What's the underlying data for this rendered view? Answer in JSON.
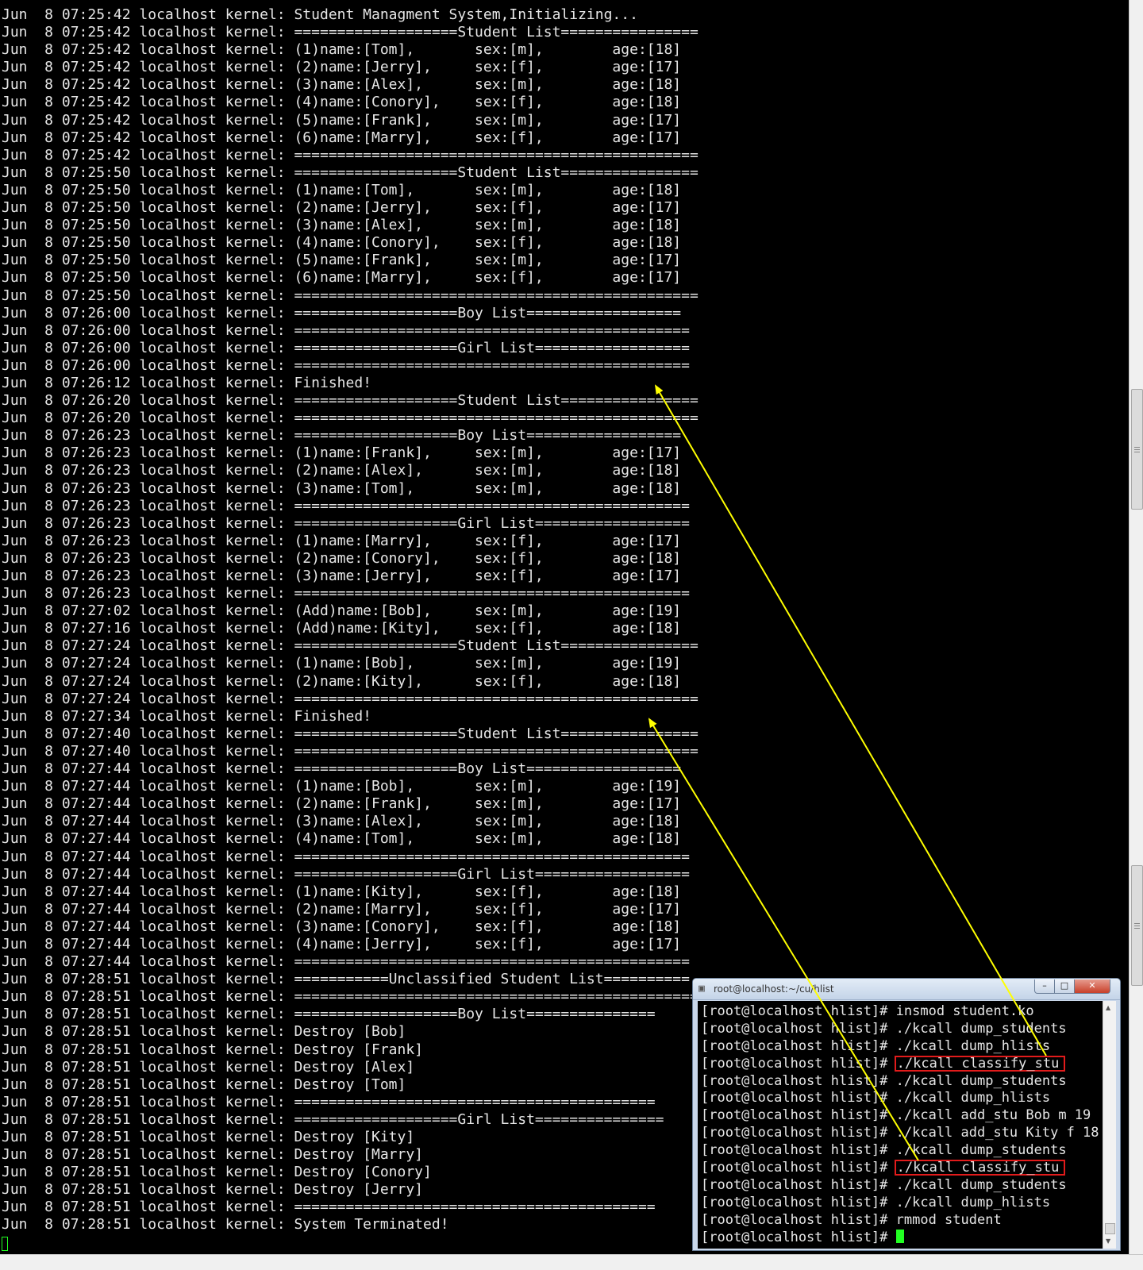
{
  "main_terminal": {
    "lines": [
      {
        "prefix": "Jun  8 07:25:42 localhost kernel: ",
        "message": "Student Managment System,Initializing..."
      },
      {
        "prefix": "Jun  8 07:25:42 localhost kernel: ",
        "message": "===================Student List================"
      },
      {
        "prefix": "Jun  8 07:25:42 localhost kernel: ",
        "message": "(1)name:[Tom],       sex:[m],        age:[18]"
      },
      {
        "prefix": "Jun  8 07:25:42 localhost kernel: ",
        "message": "(2)name:[Jerry],     sex:[f],        age:[17]"
      },
      {
        "prefix": "Jun  8 07:25:42 localhost kernel: ",
        "message": "(3)name:[Alex],      sex:[m],        age:[18]"
      },
      {
        "prefix": "Jun  8 07:25:42 localhost kernel: ",
        "message": "(4)name:[Conory],    sex:[f],        age:[18]"
      },
      {
        "prefix": "Jun  8 07:25:42 localhost kernel: ",
        "message": "(5)name:[Frank],     sex:[m],        age:[17]"
      },
      {
        "prefix": "Jun  8 07:25:42 localhost kernel: ",
        "message": "(6)name:[Marry],     sex:[f],        age:[17]"
      },
      {
        "prefix": "Jun  8 07:25:42 localhost kernel: ",
        "message": "==============================================="
      },
      {
        "prefix": "Jun  8 07:25:50 localhost kernel: ",
        "message": "===================Student List================"
      },
      {
        "prefix": "Jun  8 07:25:50 localhost kernel: ",
        "message": "(1)name:[Tom],       sex:[m],        age:[18]"
      },
      {
        "prefix": "Jun  8 07:25:50 localhost kernel: ",
        "message": "(2)name:[Jerry],     sex:[f],        age:[17]"
      },
      {
        "prefix": "Jun  8 07:25:50 localhost kernel: ",
        "message": "(3)name:[Alex],      sex:[m],        age:[18]"
      },
      {
        "prefix": "Jun  8 07:25:50 localhost kernel: ",
        "message": "(4)name:[Conory],    sex:[f],        age:[18]"
      },
      {
        "prefix": "Jun  8 07:25:50 localhost kernel: ",
        "message": "(5)name:[Frank],     sex:[m],        age:[17]"
      },
      {
        "prefix": "Jun  8 07:25:50 localhost kernel: ",
        "message": "(6)name:[Marry],     sex:[f],        age:[17]"
      },
      {
        "prefix": "Jun  8 07:25:50 localhost kernel: ",
        "message": "==============================================="
      },
      {
        "prefix": "Jun  8 07:26:00 localhost kernel: ",
        "message": "===================Boy List=================="
      },
      {
        "prefix": "Jun  8 07:26:00 localhost kernel: ",
        "message": "=============================================="
      },
      {
        "prefix": "Jun  8 07:26:00 localhost kernel: ",
        "message": "===================Girl List=================="
      },
      {
        "prefix": "Jun  8 07:26:00 localhost kernel: ",
        "message": "=============================================="
      },
      {
        "prefix": "Jun  8 07:26:12 localhost kernel: ",
        "message": "Finished!"
      },
      {
        "prefix": "Jun  8 07:26:20 localhost kernel: ",
        "message": "===================Student List================"
      },
      {
        "prefix": "Jun  8 07:26:20 localhost kernel: ",
        "message": "==============================================="
      },
      {
        "prefix": "Jun  8 07:26:23 localhost kernel: ",
        "message": "===================Boy List=================="
      },
      {
        "prefix": "Jun  8 07:26:23 localhost kernel: ",
        "message": "(1)name:[Frank],     sex:[m],        age:[17]"
      },
      {
        "prefix": "Jun  8 07:26:23 localhost kernel: ",
        "message": "(2)name:[Alex],      sex:[m],        age:[18]"
      },
      {
        "prefix": "Jun  8 07:26:23 localhost kernel: ",
        "message": "(3)name:[Tom],       sex:[m],        age:[18]"
      },
      {
        "prefix": "Jun  8 07:26:23 localhost kernel: ",
        "message": "=============================================="
      },
      {
        "prefix": "Jun  8 07:26:23 localhost kernel: ",
        "message": "===================Girl List=================="
      },
      {
        "prefix": "Jun  8 07:26:23 localhost kernel: ",
        "message": "(1)name:[Marry],     sex:[f],        age:[17]"
      },
      {
        "prefix": "Jun  8 07:26:23 localhost kernel: ",
        "message": "(2)name:[Conory],    sex:[f],        age:[18]"
      },
      {
        "prefix": "Jun  8 07:26:23 localhost kernel: ",
        "message": "(3)name:[Jerry],     sex:[f],        age:[17]"
      },
      {
        "prefix": "Jun  8 07:26:23 localhost kernel: ",
        "message": "=============================================="
      },
      {
        "prefix": "Jun  8 07:27:02 localhost kernel: ",
        "message": "(Add)name:[Bob],     sex:[m],        age:[19]"
      },
      {
        "prefix": "Jun  8 07:27:16 localhost kernel: ",
        "message": "(Add)name:[Kity],    sex:[f],        age:[18]"
      },
      {
        "prefix": "Jun  8 07:27:24 localhost kernel: ",
        "message": "===================Student List================"
      },
      {
        "prefix": "Jun  8 07:27:24 localhost kernel: ",
        "message": "(1)name:[Bob],       sex:[m],        age:[19]"
      },
      {
        "prefix": "Jun  8 07:27:24 localhost kernel: ",
        "message": "(2)name:[Kity],      sex:[f],        age:[18]"
      },
      {
        "prefix": "Jun  8 07:27:24 localhost kernel: ",
        "message": "==============================================="
      },
      {
        "prefix": "Jun  8 07:27:34 localhost kernel: ",
        "message": "Finished!"
      },
      {
        "prefix": "Jun  8 07:27:40 localhost kernel: ",
        "message": "===================Student List================"
      },
      {
        "prefix": "Jun  8 07:27:40 localhost kernel: ",
        "message": "==============================================="
      },
      {
        "prefix": "Jun  8 07:27:44 localhost kernel: ",
        "message": "===================Boy List=================="
      },
      {
        "prefix": "Jun  8 07:27:44 localhost kernel: ",
        "message": "(1)name:[Bob],       sex:[m],        age:[19]"
      },
      {
        "prefix": "Jun  8 07:27:44 localhost kernel: ",
        "message": "(2)name:[Frank],     sex:[m],        age:[17]"
      },
      {
        "prefix": "Jun  8 07:27:44 localhost kernel: ",
        "message": "(3)name:[Alex],      sex:[m],        age:[18]"
      },
      {
        "prefix": "Jun  8 07:27:44 localhost kernel: ",
        "message": "(4)name:[Tom],       sex:[m],        age:[18]"
      },
      {
        "prefix": "Jun  8 07:27:44 localhost kernel: ",
        "message": "=============================================="
      },
      {
        "prefix": "Jun  8 07:27:44 localhost kernel: ",
        "message": "===================Girl List=================="
      },
      {
        "prefix": "Jun  8 07:27:44 localhost kernel: ",
        "message": "(1)name:[Kity],      sex:[f],        age:[18]"
      },
      {
        "prefix": "Jun  8 07:27:44 localhost kernel: ",
        "message": "(2)name:[Marry],     sex:[f],        age:[17]"
      },
      {
        "prefix": "Jun  8 07:27:44 localhost kernel: ",
        "message": "(3)name:[Conory],    sex:[f],        age:[18]"
      },
      {
        "prefix": "Jun  8 07:27:44 localhost kernel: ",
        "message": "(4)name:[Jerry],     sex:[f],        age:[17]"
      },
      {
        "prefix": "Jun  8 07:27:44 localhost kernel: ",
        "message": "=============================================="
      },
      {
        "prefix": "Jun  8 07:28:51 localhost kernel: ",
        "message": "===========Unclassified Student List=========="
      },
      {
        "prefix": "Jun  8 07:28:51 localhost kernel: ",
        "message": "==============================================="
      },
      {
        "prefix": "Jun  8 07:28:51 localhost kernel: ",
        "message": "===================Boy List==============="
      },
      {
        "prefix": "Jun  8 07:28:51 localhost kernel: ",
        "message": "Destroy [Bob]"
      },
      {
        "prefix": "Jun  8 07:28:51 localhost kernel: ",
        "message": "Destroy [Frank]"
      },
      {
        "prefix": "Jun  8 07:28:51 localhost kernel: ",
        "message": "Destroy [Alex]"
      },
      {
        "prefix": "Jun  8 07:28:51 localhost kernel: ",
        "message": "Destroy [Tom]"
      },
      {
        "prefix": "Jun  8 07:28:51 localhost kernel: ",
        "message": "=========================================="
      },
      {
        "prefix": "Jun  8 07:28:51 localhost kernel: ",
        "message": "===================Girl List==============="
      },
      {
        "prefix": "Jun  8 07:28:51 localhost kernel: ",
        "message": "Destroy [Kity]"
      },
      {
        "prefix": "Jun  8 07:28:51 localhost kernel: ",
        "message": "Destroy [Marry]"
      },
      {
        "prefix": "Jun  8 07:28:51 localhost kernel: ",
        "message": "Destroy [Conory]"
      },
      {
        "prefix": "Jun  8 07:28:51 localhost kernel: ",
        "message": "Destroy [Jerry]"
      },
      {
        "prefix": "Jun  8 07:28:51 localhost kernel: ",
        "message": "=========================================="
      },
      {
        "prefix": "Jun  8 07:28:51 localhost kernel: ",
        "message": "System Terminated!"
      }
    ]
  },
  "sub_window": {
    "title": "root@localhost:~/cu/hlist",
    "app_icon": "putty-icon",
    "buttons": {
      "minimize": "–",
      "maximize": "□",
      "close": "✕"
    },
    "prompt": "[root@localhost hlist]# ",
    "commands": [
      {
        "text": "insmod student.ko",
        "highlighted": false
      },
      {
        "text": "./kcall dump_students",
        "highlighted": false
      },
      {
        "text": "./kcall dump_hlists",
        "highlighted": false
      },
      {
        "text": "./kcall classify_stu",
        "highlighted": true
      },
      {
        "text": "./kcall dump_students",
        "highlighted": false
      },
      {
        "text": "./kcall dump_hlists",
        "highlighted": false
      },
      {
        "text": "./kcall add_stu Bob m 19",
        "highlighted": false
      },
      {
        "text": "./kcall add_stu Kity f 18",
        "highlighted": false
      },
      {
        "text": "./kcall dump_students",
        "highlighted": false
      },
      {
        "text": "./kcall classify_stu",
        "highlighted": true
      },
      {
        "text": "./kcall dump_students",
        "highlighted": false
      },
      {
        "text": "./kcall dump_hlists",
        "highlighted": false
      },
      {
        "text": "rmmod student",
        "highlighted": false
      },
      {
        "text": "",
        "highlighted": false
      }
    ]
  },
  "colors": {
    "terminal_bg": "#000000",
    "terminal_fg": "#e6e6e6",
    "cursor": "#22ff22",
    "highlight_box": "#e21b1b",
    "annotation_arrow": "#ffff00"
  }
}
